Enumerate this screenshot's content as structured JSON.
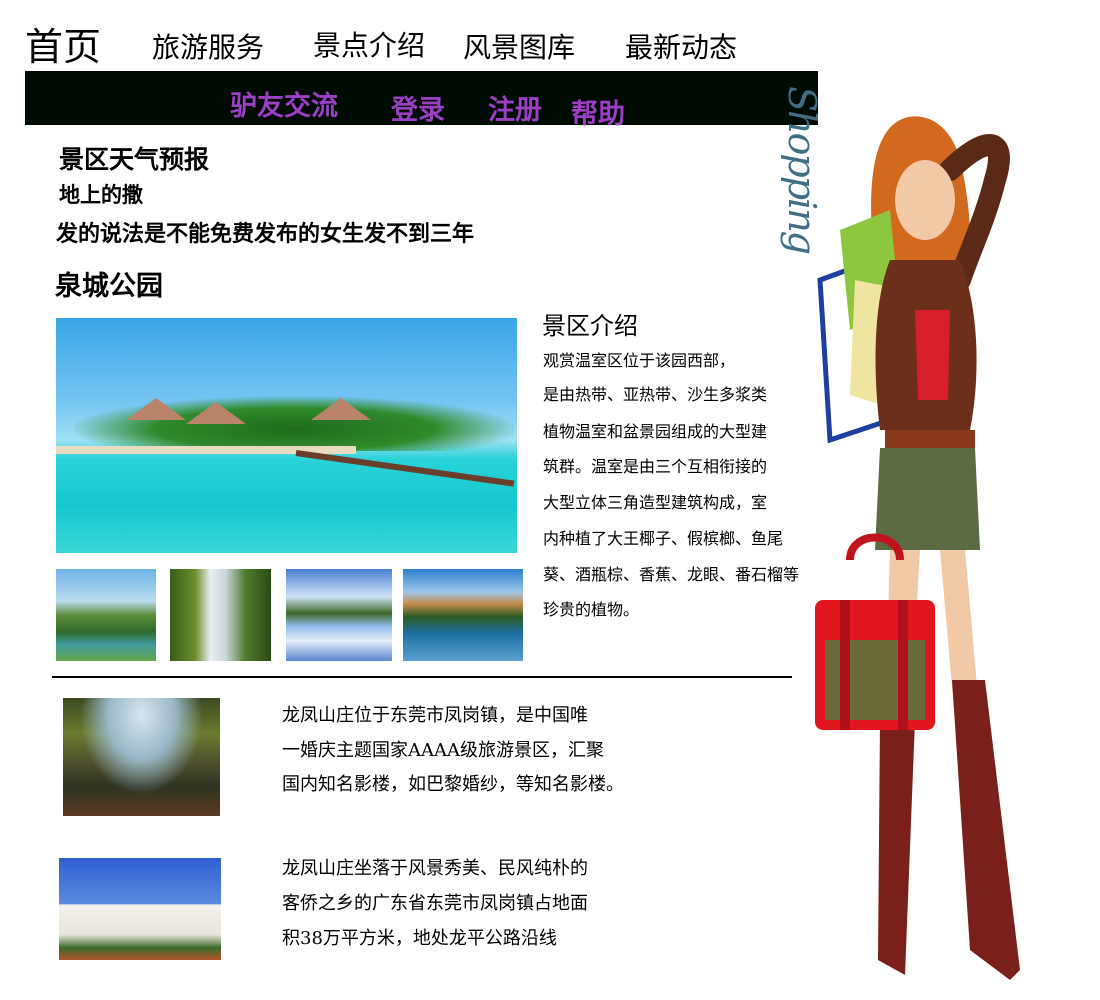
{
  "nav": {
    "home": "首页",
    "travel_service": "旅游服务",
    "scenic_intro": "景点介绍",
    "gallery": "风景图库",
    "news": "最新动态",
    "forum": "驴友交流",
    "login": "登录",
    "register": "注册",
    "help": "帮助"
  },
  "weather": {
    "title": "景区天气预报",
    "line1": "地上的撒",
    "line2": "发的说法是不能免费发布的女生发不到三年"
  },
  "park": {
    "title": "泉城公园",
    "intro_title": "景区介绍",
    "intro_lines": [
      "观赏温室区位于该园西部，",
      "是由热带、亚热带、沙生多浆类",
      "植物温室和盆景园组成的大型建",
      "筑群。温室是由三个互相衔接的",
      "大型立体三角造型建筑构成，室",
      "内种植了大王椰子、假槟榔、鱼尾",
      "葵、酒瓶棕、香蕉、龙眼、番石榴等",
      "珍贵的植物。"
    ]
  },
  "articles": [
    {
      "lines": [
        "龙凤山庄位于东莞市凤岗镇，是中国唯",
        "一婚庆主题国家AAAA级旅游景区，汇聚",
        "国内知名影楼，如巴黎婚纱，等知名影楼。"
      ]
    },
    {
      "lines": [
        "龙凤山庄坐落于风景秀美、民风纯朴的",
        "客侨之乡的广东省东莞市凤岗镇占地面",
        "积38万平方米，地处龙平公路沿线"
      ]
    }
  ],
  "decor": {
    "shopping_text": "Shopping"
  },
  "colors": {
    "nav_bar_bg": "#000b04",
    "nav_secondary_text": "#9b3fc4"
  }
}
